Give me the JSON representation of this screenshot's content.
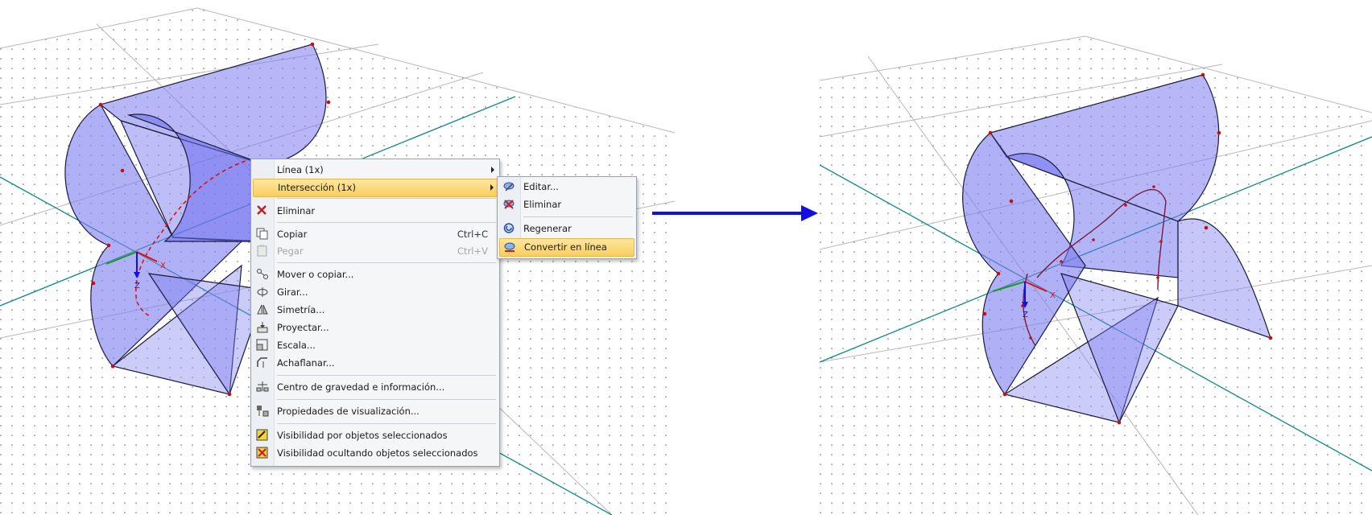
{
  "main_menu": {
    "items": [
      {
        "label": "Línea (1x)",
        "has_submenu": true,
        "icon": "none"
      },
      {
        "label": "Intersección (1x)",
        "has_submenu": true,
        "highlighted": true,
        "icon": "none"
      },
      {
        "label": "Eliminar",
        "icon": "delete-x-icon"
      },
      {
        "label": "Copiar",
        "shortcut": "Ctrl+C",
        "icon": "copy-icon"
      },
      {
        "label": "Pegar",
        "shortcut": "Ctrl+V",
        "disabled": true,
        "icon": "paste-icon"
      },
      {
        "label": "Mover o copiar...",
        "icon": "move-copy-icon"
      },
      {
        "label": "Girar...",
        "icon": "rotate-icon"
      },
      {
        "label": "Simetría...",
        "icon": "mirror-icon"
      },
      {
        "label": "Proyectar...",
        "icon": "project-icon"
      },
      {
        "label": "Escala...",
        "icon": "scale-icon"
      },
      {
        "label": "Achaflanar...",
        "icon": "chamfer-icon"
      },
      {
        "label": "Centro de gravedad e información...",
        "icon": "center-of-gravity-icon"
      },
      {
        "label": "Propiedades de visualización...",
        "icon": "display-properties-icon"
      },
      {
        "label": "Visibilidad por objetos seleccionados",
        "icon": "visibility-selected-icon"
      },
      {
        "label": "Visibilidad ocultando objetos seleccionados",
        "icon": "visibility-hide-selected-icon"
      }
    ]
  },
  "sub_menu": {
    "items": [
      {
        "label": "Editar...",
        "icon": "edit-intersection-icon"
      },
      {
        "label": "Eliminar",
        "icon": "delete-intersection-icon"
      },
      {
        "label": "Regenerar",
        "icon": "regenerate-icon"
      },
      {
        "label": "Convertir en línea",
        "highlighted": true,
        "icon": "convert-to-line-icon"
      }
    ]
  },
  "axes": {
    "x_label": "X",
    "z_label": "Z"
  },
  "colors": {
    "surface_fill": "#7b7cf0",
    "grid_line": "#0e8a8a",
    "arrow": "#1010e0",
    "node": "#c01010",
    "menu_highlight": "#f9ce5d"
  }
}
